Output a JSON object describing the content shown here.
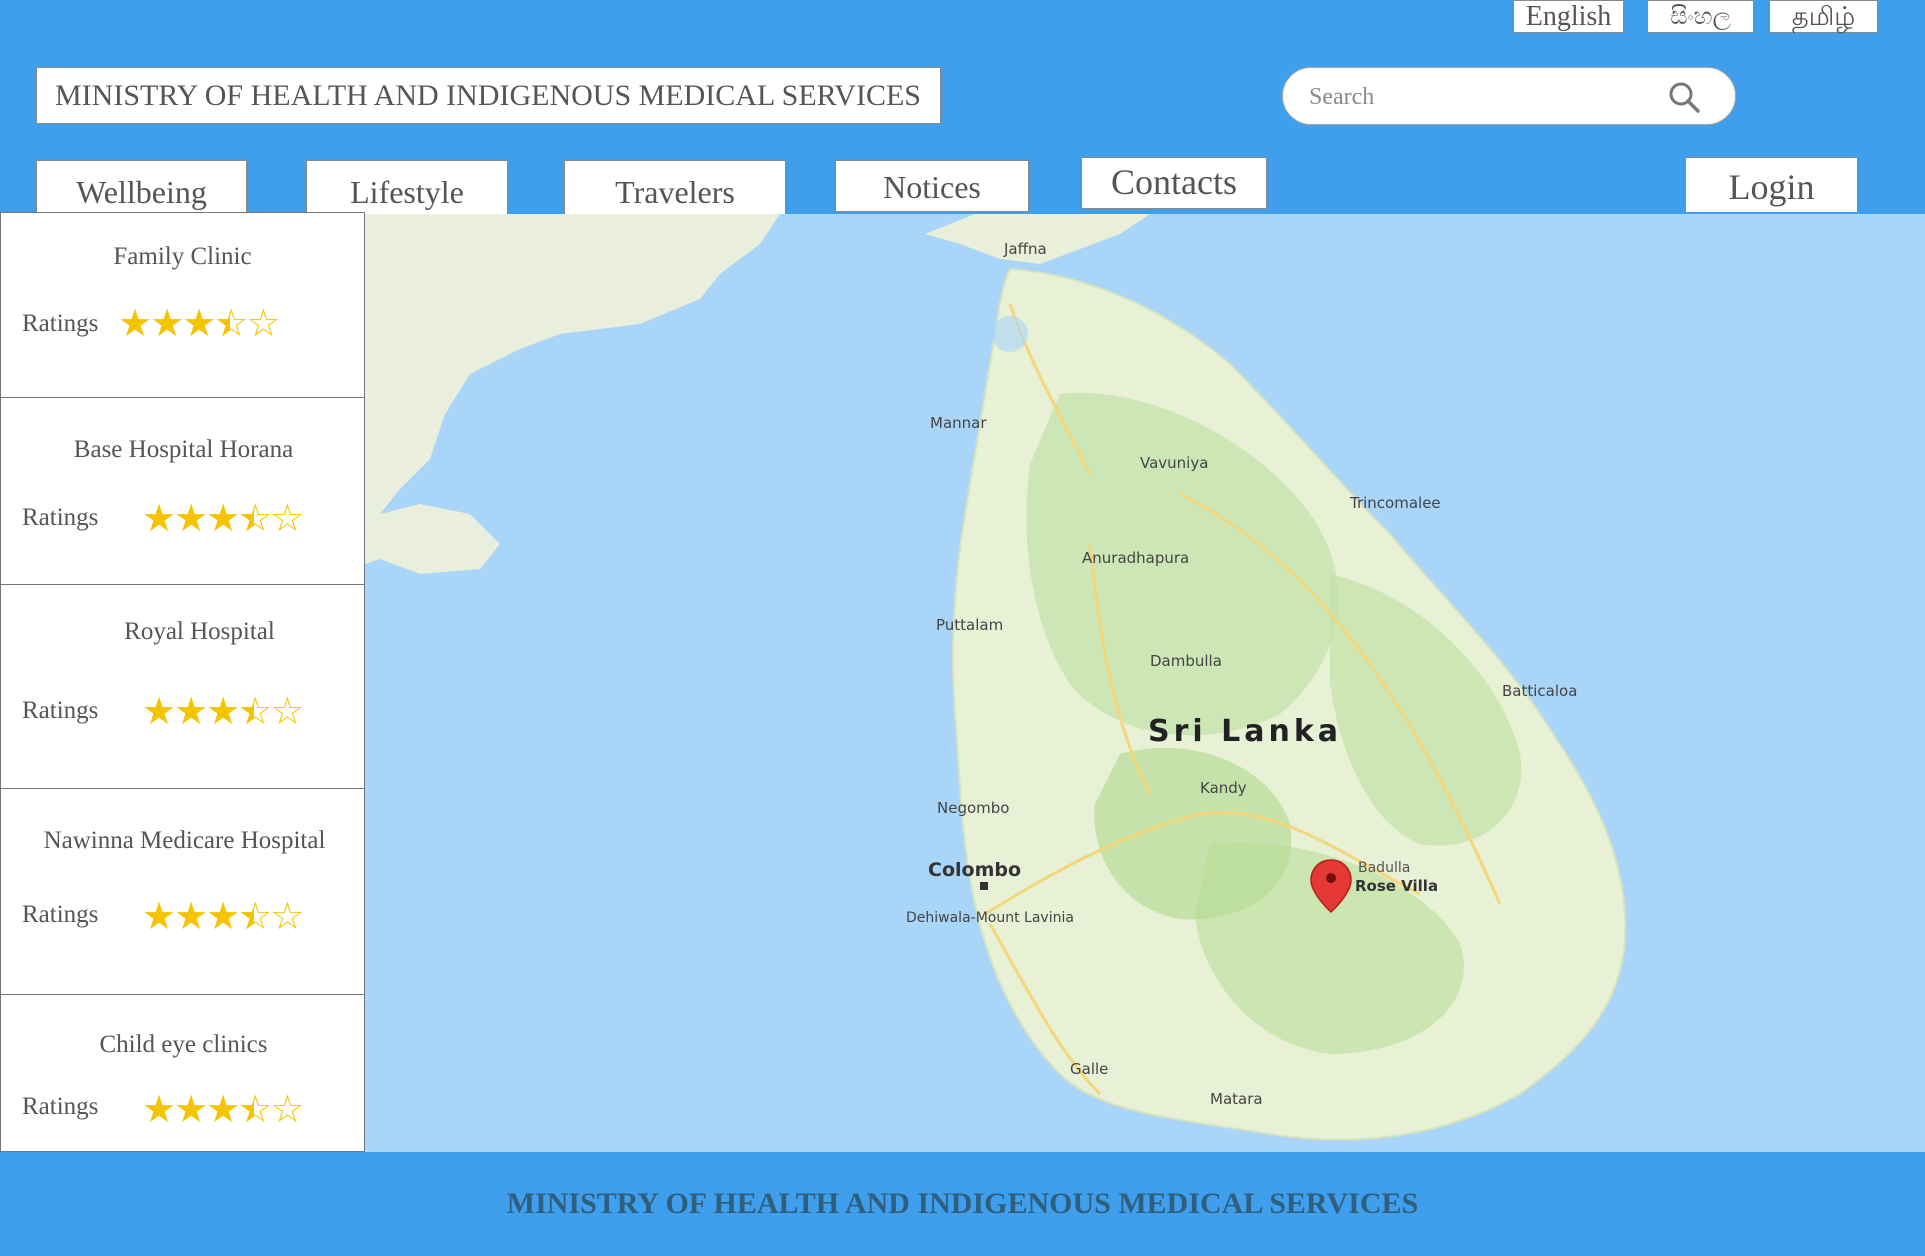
{
  "header": {
    "languages": [
      "English",
      "සිංහල",
      "தமிழ்"
    ],
    "title": "MINISTRY OF HEALTH AND INDIGENOUS MEDICAL SERVICES",
    "search": {
      "placeholder": "Search",
      "icon": "search-icon"
    },
    "nav": [
      "Wellbeing",
      "Lifestyle",
      "Travelers",
      "Notices",
      "Contacts"
    ],
    "login_label": "Login"
  },
  "map": {
    "country_label": "Sri Lanka",
    "cities": [
      "Colombo",
      "Kandy",
      "Negombo",
      "Galle",
      "Jaffna",
      "Trincomalee",
      "Batticaloa",
      "Anuradhapura",
      "Dambulla",
      "Dehiwala-Mount Lavinia",
      "Matara",
      "Vavuniya",
      "Puttalam",
      "Mannar"
    ],
    "pin_label_1": "Badulla",
    "pin_label_2": "Rose Villa",
    "pin_icon": "map-pin-icon"
  },
  "hospitals": [
    {
      "name": "Family Clinic",
      "ratings_label": "Ratings",
      "rating": 3.5,
      "max": 5
    },
    {
      "name": "Base Hospital Horana",
      "ratings_label": "Ratings",
      "rating": 3.5,
      "max": 5
    },
    {
      "name": "Royal Hospital",
      "ratings_label": "Ratings",
      "rating": 3.5,
      "max": 5
    },
    {
      "name": "Nawinna Medicare Hospital",
      "ratings_label": "Ratings",
      "rating": 3.5,
      "max": 5
    },
    {
      "name": "Child eye clinics",
      "ratings_label": "Ratings",
      "rating": 3.5,
      "max": 5
    }
  ],
  "footer": {
    "title": "MINISTRY OF HEALTH AND INDIGENOUS MEDICAL SERVICES"
  },
  "colors": {
    "header_bg": "#3f9fec",
    "star": "#f5c400",
    "sea": "#a9d5f9",
    "land": "#e7efd6",
    "forest": "#bfe0a6",
    "pin": "#e53935"
  }
}
